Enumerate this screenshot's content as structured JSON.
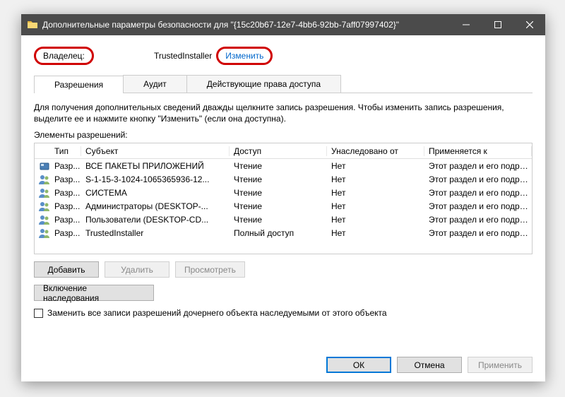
{
  "titlebar": {
    "title": "Дополнительные параметры безопасности для \"{15c20b67-12e7-4bb6-92bb-7aff07997402}\""
  },
  "owner": {
    "label": "Владелец:",
    "value": "TrustedInstaller",
    "change": "Изменить"
  },
  "tabs": {
    "permissions": "Разрешения",
    "audit": "Аудит",
    "effective": "Действующие права доступа"
  },
  "info_text": "Для получения дополнительных сведений дважды щелкните запись разрешения. Чтобы изменить запись разрешения, выделите ее и нажмите кнопку \"Изменить\" (если она доступна).",
  "elements_label": "Элементы разрешений:",
  "columns": {
    "type": "Тип",
    "subject": "Субъект",
    "access": "Доступ",
    "inherited": "Унаследовано от",
    "applies": "Применяется к"
  },
  "rows": [
    {
      "type": "Разр...",
      "subject": "ВСЕ ПАКЕТЫ ПРИЛОЖЕНИЙ",
      "access": "Чтение",
      "inherited": "Нет",
      "applies": "Этот раздел и его подразделы"
    },
    {
      "type": "Разр...",
      "subject": "S-1-15-3-1024-1065365936-12...",
      "access": "Чтение",
      "inherited": "Нет",
      "applies": "Этот раздел и его подразделы"
    },
    {
      "type": "Разр...",
      "subject": "СИСТЕМА",
      "access": "Чтение",
      "inherited": "Нет",
      "applies": "Этот раздел и его подразделы"
    },
    {
      "type": "Разр...",
      "subject": "Администраторы (DESKTOP-...",
      "access": "Чтение",
      "inherited": "Нет",
      "applies": "Этот раздел и его подразделы"
    },
    {
      "type": "Разр...",
      "subject": "Пользователи (DESKTOP-CD...",
      "access": "Чтение",
      "inherited": "Нет",
      "applies": "Этот раздел и его подразделы"
    },
    {
      "type": "Разр...",
      "subject": "TrustedInstaller",
      "access": "Полный доступ",
      "inherited": "Нет",
      "applies": "Этот раздел и его подразделы"
    }
  ],
  "buttons": {
    "add": "Добавить",
    "remove": "Удалить",
    "view": "Просмотреть",
    "inherit": "Включение наследования",
    "replace_chk": "Заменить все записи разрешений дочернего объекта наследуемыми от этого объекта",
    "ok": "ОК",
    "cancel": "Отмена",
    "apply": "Применить"
  }
}
